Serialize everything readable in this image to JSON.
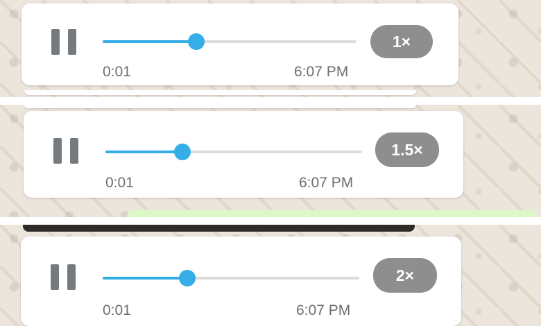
{
  "players": [
    {
      "pause_icon": "pause-icon",
      "progress": 0.37,
      "elapsed": "0:01",
      "timestamp": "6:07 PM",
      "speed": "1×"
    },
    {
      "pause_icon": "pause-icon",
      "progress": 0.3,
      "elapsed": "0:01",
      "timestamp": "6:07 PM",
      "speed": "1.5×"
    },
    {
      "pause_icon": "pause-icon",
      "progress": 0.33,
      "elapsed": "0:01",
      "timestamp": "6:07 PM",
      "speed": "2×"
    }
  ],
  "colors": {
    "accent": "#35aee8",
    "wallpaper": "#ece5dc",
    "speed_badge": "#8e8e8e",
    "outgoing_bubble": "#dcf8c6"
  }
}
